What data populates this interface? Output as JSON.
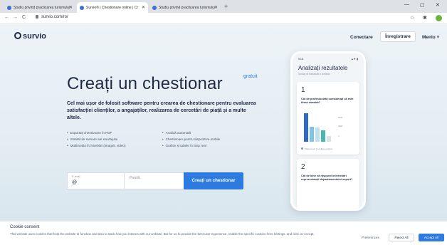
{
  "browser": {
    "tabs": [
      {
        "title": "Studiu privind practicarea turismului",
        "active": false
      },
      {
        "title": "Survio® | Chestionare online | Cr",
        "active": true
      },
      {
        "title": "Studiu privind practicarea turismului",
        "active": false
      }
    ],
    "new_tab": "+",
    "url": "survio.com/ro/",
    "controls": {
      "minimize": "—",
      "maximize": "▢",
      "close": "✕"
    },
    "nav": {
      "back": "←",
      "forward": "→",
      "reload": "C"
    }
  },
  "header": {
    "logo": "survio",
    "login": "Conectare",
    "register": "Înregistrare",
    "menu": "Meniu ≡"
  },
  "hero": {
    "title": "Creați un chestionar",
    "badge": "gratuit",
    "subtitle": "Cel mai ușor de folosit software pentru crearea de chestionare pentru evaluarea satisfacției clienților, a angajaților, realizarea de cercetări de piață și a multe altele.",
    "features_left": [
      "Exportați chestionare în PDF",
      "Statisticile sumare ale sondajului",
      "Multimedia în întrebări (imagini, video)"
    ],
    "features_right": [
      "Analiză automată",
      "Chestionare pentru dispozitive mobile",
      "Grafice și tabele în timp real"
    ]
  },
  "signup_form": {
    "email_label": "E-mail",
    "email_value": "@",
    "password_placeholder": "Parolă",
    "submit": "Creați un chestionar"
  },
  "phone": {
    "time": "9:18",
    "status": "▲▼ ▮",
    "title": "Analizați rezultatele",
    "subtitle": "Sondaj de satisfacție a clienților",
    "card1": {
      "number": "1",
      "question": "Cât de profesionistă considerați că este firma noastră?",
      "note": "Răspunsuri (rezultate grafice)"
    },
    "card2": {
      "number": "2",
      "question": "Cât de bine vă răspund la întrebări reprezentanții departamentului suport?"
    }
  },
  "chart_data": {
    "type": "bar",
    "categories": [
      "1",
      "2",
      "3",
      "4",
      "5"
    ],
    "values": [
      4,
      2.1,
      2.0,
      1.6,
      0.8
    ],
    "colors": [
      "#2b68c8",
      "#7fc3e6",
      "#bfe0ee",
      "#48b7b0",
      "#d9e3ea"
    ],
    "tick_labels": [
      "6000",
      "4000",
      "0"
    ],
    "ylim": [
      0,
      6000
    ]
  },
  "cookie": {
    "title": "Cookie consent",
    "text": "This website uses cookies that help the website to function and also to track how you interact with our website. But for us to provide the best user experience, enable the specific cookies from Settings, and click on Accept.",
    "preferences": "Preferences",
    "reject": "Reject All",
    "accept": "Accept All"
  },
  "colors": {
    "accent": "#2d7be0",
    "text": "#1f2a44"
  }
}
